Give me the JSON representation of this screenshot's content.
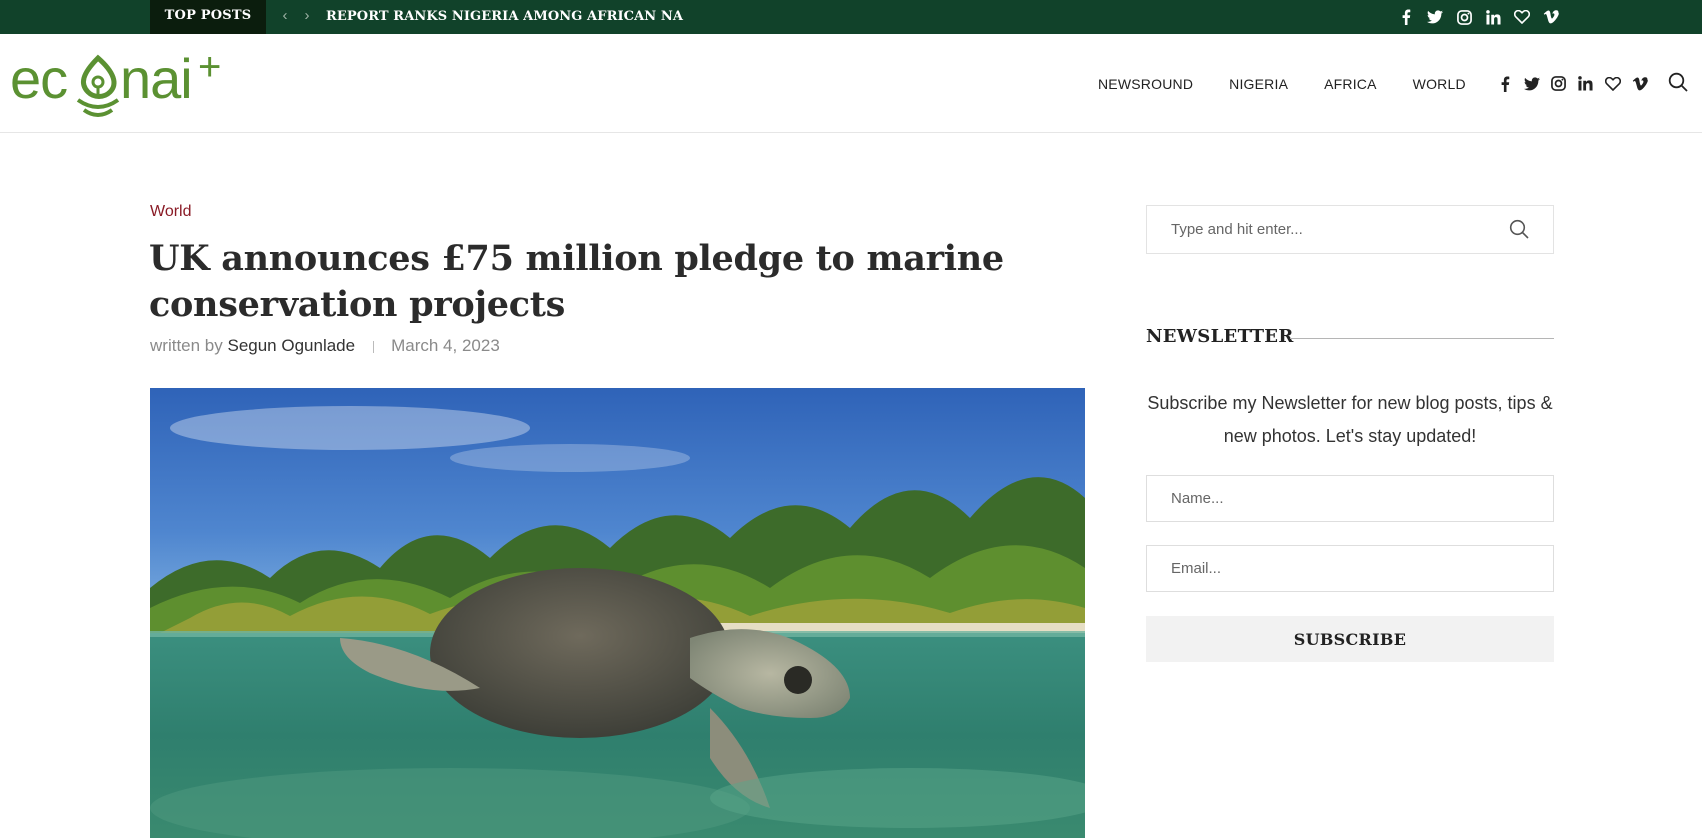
{
  "topbar": {
    "label": "TOP POSTS",
    "ticker": "REPORT RANKS NIGERIA AMONG AFRICAN NA",
    "prev_icon": "chevron-left-icon",
    "next_icon": "chevron-right-icon",
    "socials": [
      "facebook-icon",
      "twitter-icon",
      "instagram-icon",
      "linkedin-icon",
      "heart-icon",
      "vimeo-icon"
    ],
    "bg_color": "#11422a",
    "label_bg_color": "#0b1d0d"
  },
  "header": {
    "logo_text": "econai+",
    "nav": [
      "NEWSROUND",
      "NIGERIA",
      "AFRICA",
      "WORLD"
    ],
    "socials": [
      "facebook-icon",
      "twitter-icon",
      "instagram-icon",
      "linkedin-icon",
      "heart-icon",
      "vimeo-icon"
    ],
    "search_icon": "search-icon",
    "logo_color": "#5b9132"
  },
  "article": {
    "category": "World",
    "title": "UK announces £75 million pledge to marine conservation projects",
    "written_by": "written by",
    "author": "Segun Ogunlade",
    "date": "March 4, 2023",
    "category_color": "#8a1b26"
  },
  "sidebar": {
    "search_placeholder": "Type and hit enter...",
    "newsletter_title": "NEWSLETTER",
    "newsletter_text": "Subscribe my Newsletter for new blog posts, tips & new photos. Let's stay updated!",
    "name_placeholder": "Name...",
    "email_placeholder": "Email...",
    "subscribe_label": "SUBSCRIBE"
  }
}
